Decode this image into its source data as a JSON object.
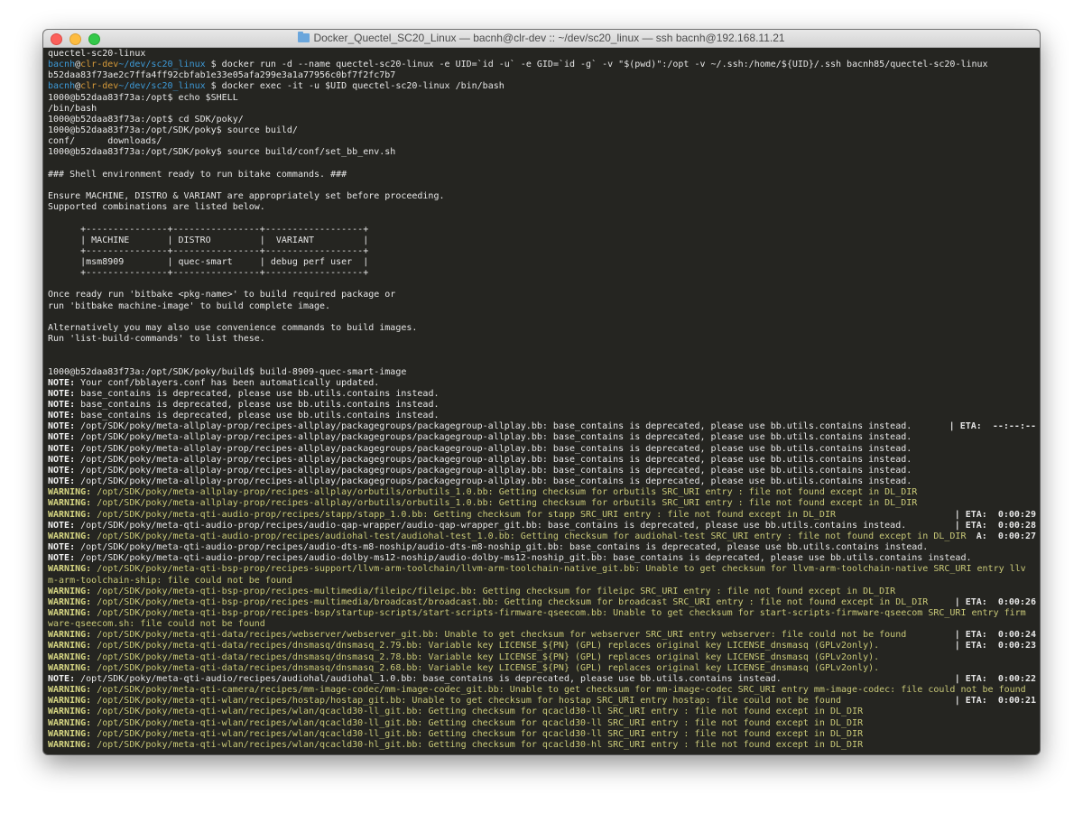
{
  "window": {
    "title": "Docker_Quectel_SC20_Linux — bacnh@clr-dev :: ~/dev/sc20_linux — ssh bacnh@192.168.11.21",
    "title_icon": "folder-icon",
    "buttons": [
      "close",
      "minimize",
      "zoom"
    ]
  },
  "colors": {
    "background": "#252521",
    "user": "#3d9ad8",
    "host": "#d69a3a",
    "warning": "#c9c978",
    "text": "#e6e6e6"
  },
  "terminal": {
    "lines": [
      {
        "k": "plain",
        "text": "quectel-sc20-linux"
      },
      {
        "k": "user",
        "user": "bacnh",
        "at": "@",
        "host": "clr-dev",
        "path": "~/dev/sc20_linux",
        "cmd": " $ docker run -d --name quectel-sc20-linux -e UID=`id -u` -e GID=`id -g` -v \"$(pwd)\":/opt -v ~/.ssh:/home/${UID}/.ssh bacnh85/quectel-sc20-linux"
      },
      {
        "k": "plain",
        "text": "b52daa83f73ae2c7ffa4ff92cbfab1e33e05afa299e3a1a77956c0bf7f2fc7b7"
      },
      {
        "k": "user",
        "user": "bacnh",
        "at": "@",
        "host": "clr-dev",
        "path": "~/dev/sc20_linux",
        "cmd": " $ docker exec -it -u $UID quectel-sc20-linux /bin/bash"
      },
      {
        "k": "plain",
        "text": "1000@b52daa83f73a:/opt$ echo $SHELL"
      },
      {
        "k": "plain",
        "text": "/bin/bash"
      },
      {
        "k": "plain",
        "text": "1000@b52daa83f73a:/opt$ cd SDK/poky/"
      },
      {
        "k": "plain",
        "text": "1000@b52daa83f73a:/opt/SDK/poky$ source build/"
      },
      {
        "k": "plain",
        "text": "conf/      downloads/"
      },
      {
        "k": "plain",
        "text": "1000@b52daa83f73a:/opt/SDK/poky$ source build/conf/set_bb_env.sh"
      },
      {
        "k": "plain",
        "text": ""
      },
      {
        "k": "plain",
        "text": "### Shell environment ready to run bitake commands. ###"
      },
      {
        "k": "plain",
        "text": ""
      },
      {
        "k": "plain",
        "text": "Ensure MACHINE, DISTRO & VARIANT are appropriately set before proceeding."
      },
      {
        "k": "plain",
        "text": "Supported combinations are listed below."
      },
      {
        "k": "plain",
        "text": ""
      },
      {
        "k": "plain",
        "text": "      +---------------+----------------+------------------+"
      },
      {
        "k": "plain",
        "text": "      | MACHINE       | DISTRO         |  VARIANT         |"
      },
      {
        "k": "plain",
        "text": "      +---------------+----------------+------------------+"
      },
      {
        "k": "plain",
        "text": "      |msm8909        | quec-smart     | debug perf user  |"
      },
      {
        "k": "plain",
        "text": "      +---------------+----------------+------------------+"
      },
      {
        "k": "plain",
        "text": ""
      },
      {
        "k": "plain",
        "text": "Once ready run 'bitbake <pkg-name>' to build required package or"
      },
      {
        "k": "plain",
        "text": "run 'bitbake machine-image' to build complete image."
      },
      {
        "k": "plain",
        "text": ""
      },
      {
        "k": "plain",
        "text": "Alternatively you may also use convenience commands to build images."
      },
      {
        "k": "plain",
        "text": "Run 'list-build-commands' to list these."
      },
      {
        "k": "plain",
        "text": ""
      },
      {
        "k": "plain",
        "text": ""
      },
      {
        "k": "plain",
        "text": "1000@b52daa83f73a:/opt/SDK/poky/build$ build-8909-quec-smart-image"
      },
      {
        "k": "note",
        "label": "NOTE:",
        "text": " Your conf/bblayers.conf has been automatically updated."
      },
      {
        "k": "note",
        "label": "NOTE:",
        "text": " base_contains is deprecated, please use bb.utils.contains instead."
      },
      {
        "k": "note",
        "label": "NOTE:",
        "text": " base_contains is deprecated, please use bb.utils.contains instead."
      },
      {
        "k": "note",
        "label": "NOTE:",
        "text": " base_contains is deprecated, please use bb.utils.contains instead."
      },
      {
        "k": "note",
        "label": "NOTE:",
        "text": " /opt/SDK/poky/meta-allplay-prop/recipes-allplay/packagegroups/packagegroup-allplay.bb: base_contains is deprecated, please use bb.utils.contains instead.",
        "eta": "| ETA:  --:--:--"
      },
      {
        "k": "note",
        "label": "NOTE:",
        "text": " /opt/SDK/poky/meta-allplay-prop/recipes-allplay/packagegroups/packagegroup-allplay.bb: base_contains is deprecated, please use bb.utils.contains instead."
      },
      {
        "k": "note",
        "label": "NOTE:",
        "text": " /opt/SDK/poky/meta-allplay-prop/recipes-allplay/packagegroups/packagegroup-allplay.bb: base_contains is deprecated, please use bb.utils.contains instead."
      },
      {
        "k": "note",
        "label": "NOTE:",
        "text": " /opt/SDK/poky/meta-allplay-prop/recipes-allplay/packagegroups/packagegroup-allplay.bb: base_contains is deprecated, please use bb.utils.contains instead."
      },
      {
        "k": "note",
        "label": "NOTE:",
        "text": " /opt/SDK/poky/meta-allplay-prop/recipes-allplay/packagegroups/packagegroup-allplay.bb: base_contains is deprecated, please use bb.utils.contains instead."
      },
      {
        "k": "note",
        "label": "NOTE:",
        "text": " /opt/SDK/poky/meta-allplay-prop/recipes-allplay/packagegroups/packagegroup-allplay.bb: base_contains is deprecated, please use bb.utils.contains instead."
      },
      {
        "k": "warn",
        "label": "WARNING:",
        "text": " /opt/SDK/poky/meta-allplay-prop/recipes-allplay/orbutils/orbutils_1.0.bb: Getting checksum for orbutils SRC_URI entry : file not found except in DL_DIR"
      },
      {
        "k": "warn",
        "label": "WARNING:",
        "text": " /opt/SDK/poky/meta-allplay-prop/recipes-allplay/orbutils/orbutils_1.0.bb: Getting checksum for orbutils SRC_URI entry : file not found except in DL_DIR"
      },
      {
        "k": "warn",
        "label": "WARNING:",
        "text": " /opt/SDK/poky/meta-qti-audio-prop/recipes/stapp/stapp_1.0.bb: Getting checksum for stapp SRC_URI entry : file not found except in DL_DIR",
        "eta": "| ETA:  0:00:29"
      },
      {
        "k": "note",
        "label": "NOTE:",
        "text": " /opt/SDK/poky/meta-qti-audio-prop/recipes/audio-qap-wrapper/audio-qap-wrapper_git.bb: base_contains is deprecated, please use bb.utils.contains instead.",
        "eta": "| ETA:  0:00:28"
      },
      {
        "k": "warn",
        "label": "WARNING:",
        "text": " /opt/SDK/poky/meta-qti-audio-prop/recipes/audiohal-test/audiohal-test_1.0.bb: Getting checksum for audiohal-test SRC_URI entry : file not found except in DL_DIR",
        "eta": "A:  0:00:27"
      },
      {
        "k": "note",
        "label": "NOTE:",
        "text": " /opt/SDK/poky/meta-qti-audio-prop/recipes/audio-dts-m8-noship/audio-dts-m8-noship_git.bb: base_contains is deprecated, please use bb.utils.contains instead."
      },
      {
        "k": "note",
        "label": "NOTE:",
        "text": " /opt/SDK/poky/meta-qti-audio-prop/recipes/audio-dolby-ms12-noship/audio-dolby-ms12-noship_git.bb: base_contains is deprecated, please use bb.utils.contains instead."
      },
      {
        "k": "warn",
        "label": "WARNING:",
        "text": " /opt/SDK/poky/meta-qti-bsp-prop/recipes-support/llvm-arm-toolchain/llvm-arm-toolchain-native_git.bb: Unable to get checksum for llvm-arm-toolchain-native SRC_URI entry llv"
      },
      {
        "k": "warnc",
        "text": "m-arm-toolchain-ship: file could not be found"
      },
      {
        "k": "warn",
        "label": "WARNING:",
        "text": " /opt/SDK/poky/meta-qti-bsp-prop/recipes-multimedia/fileipc/fileipc.bb: Getting checksum for fileipc SRC_URI entry : file not found except in DL_DIR"
      },
      {
        "k": "warn",
        "label": "WARNING:",
        "text": " /opt/SDK/poky/meta-qti-bsp-prop/recipes-multimedia/broadcast/broadcast.bb: Getting checksum for broadcast SRC_URI entry : file not found except in DL_DIR",
        "eta": "| ETA:  0:00:26"
      },
      {
        "k": "warn",
        "label": "WARNING:",
        "text": " /opt/SDK/poky/meta-qti-bsp-prop/recipes-bsp/startup-scripts/start-scripts-firmware-qseecom.bb: Unable to get checksum for start-scripts-firmware-qseecom SRC_URI entry firm"
      },
      {
        "k": "warnc",
        "text": "ware-qseecom.sh: file could not be found"
      },
      {
        "k": "warn",
        "label": "WARNING:",
        "text": " /opt/SDK/poky/meta-qti-data/recipes/webserver/webserver_git.bb: Unable to get checksum for webserver SRC_URI entry webserver: file could not be found",
        "eta": "| ETA:  0:00:24"
      },
      {
        "k": "warn",
        "label": "WARNING:",
        "text": " /opt/SDK/poky/meta-qti-data/recipes/dnsmasq/dnsmasq_2.79.bb: Variable key LICENSE_${PN} (GPL) replaces original key LICENSE_dnsmasq (GPLv2only).",
        "eta": "| ETA:  0:00:23"
      },
      {
        "k": "warn",
        "label": "WARNING:",
        "text": " /opt/SDK/poky/meta-qti-data/recipes/dnsmasq/dnsmasq_2.78.bb: Variable key LICENSE_${PN} (GPL) replaces original key LICENSE_dnsmasq (GPLv2only)."
      },
      {
        "k": "warn",
        "label": "WARNING:",
        "text": " /opt/SDK/poky/meta-qti-data/recipes/dnsmasq/dnsmasq_2.68.bb: Variable key LICENSE_${PN} (GPL) replaces original key LICENSE_dnsmasq (GPLv2only)."
      },
      {
        "k": "note",
        "label": "NOTE:",
        "text": " /opt/SDK/poky/meta-qti-audio/recipes/audiohal/audiohal_1.0.bb: base_contains is deprecated, please use bb.utils.contains instead.",
        "eta": "| ETA:  0:00:22"
      },
      {
        "k": "warn",
        "label": "WARNING:",
        "text": " /opt/SDK/poky/meta-qti-camera/recipes/mm-image-codec/mm-image-codec_git.bb: Unable to get checksum for mm-image-codec SRC_URI entry mm-image-codec: file could not be found"
      },
      {
        "k": "warn",
        "label": "WARNING:",
        "text": " /opt/SDK/poky/meta-qti-wlan/recipes/hostap/hostap_git.bb: Unable to get checksum for hostap SRC_URI entry hostap: file could not be found",
        "eta": "| ETA:  0:00:21"
      },
      {
        "k": "warn",
        "label": "WARNING:",
        "text": " /opt/SDK/poky/meta-qti-wlan/recipes/wlan/qcacld30-ll_git.bb: Getting checksum for qcacld30-ll SRC_URI entry : file not found except in DL_DIR"
      },
      {
        "k": "warn",
        "label": "WARNING:",
        "text": " /opt/SDK/poky/meta-qti-wlan/recipes/wlan/qcacld30-ll_git.bb: Getting checksum for qcacld30-ll SRC_URI entry : file not found except in DL_DIR"
      },
      {
        "k": "warn",
        "label": "WARNING:",
        "text": " /opt/SDK/poky/meta-qti-wlan/recipes/wlan/qcacld30-ll_git.bb: Getting checksum for qcacld30-ll SRC_URI entry : file not found except in DL_DIR"
      },
      {
        "k": "warn",
        "label": "WARNING:",
        "text": " /opt/SDK/poky/meta-qti-wlan/recipes/wlan/qcacld30-hl_git.bb: Getting checksum for qcacld30-hl SRC_URI entry : file not found except in DL_DIR"
      }
    ]
  }
}
